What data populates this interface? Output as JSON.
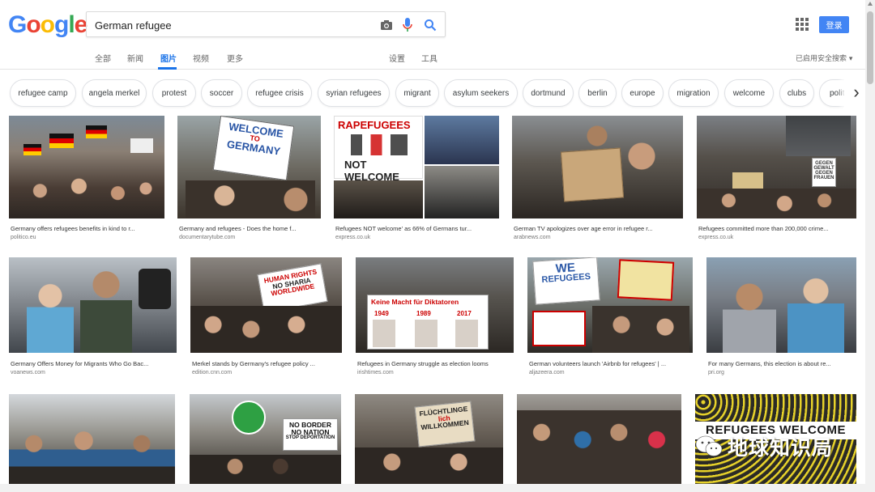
{
  "logo": {
    "letters": [
      "G",
      "o",
      "o",
      "g",
      "l",
      "e"
    ],
    "colors": [
      "#4285f4",
      "#ea4335",
      "#fbbc05",
      "#4285f4",
      "#34a853",
      "#ea4335"
    ]
  },
  "search": {
    "query": "German refugee"
  },
  "header": {
    "login_label": "登录"
  },
  "nav": {
    "tabs": [
      "全部",
      "新闻",
      "图片",
      "视频",
      "更多"
    ],
    "active_tab": "图片",
    "settings": "设置",
    "tools": "工具",
    "safe_search": "已启用安全搜索 ▾"
  },
  "chips": [
    "refugee camp",
    "angela merkel",
    "protest",
    "soccer",
    "refugee crisis",
    "syrian refugees",
    "migrant",
    "asylum seekers",
    "dortmund",
    "berlin",
    "europe",
    "migration",
    "welcome",
    "clubs",
    "politi"
  ],
  "results": [
    {
      "caption": "Germany offers refugees benefits in kind to r...",
      "source": "politico.eu"
    },
    {
      "caption": "Germany and refugees - Does the home f...",
      "source": "documentarytube.com"
    },
    {
      "caption": "Refugees NOT welcome' as 66% of Germans tur...",
      "source": "express.co.uk"
    },
    {
      "caption": "German TV apologizes over age error in refugee r...",
      "source": "arabnews.com"
    },
    {
      "caption": "Refugees committed more than 200,000 crime...",
      "source": "express.co.uk"
    },
    {
      "caption": "Germany Offers Money for Migrants Who Go Bac...",
      "source": "voanews.com"
    },
    {
      "caption": "Merkel stands by Germany's refugee policy ...",
      "source": "edition.cnn.com"
    },
    {
      "caption": "Refugees in Germany struggle as election looms",
      "source": "irishtimes.com"
    },
    {
      "caption": "German volunteers launch 'Airbnb for refugees' | ...",
      "source": "aljazeera.com"
    },
    {
      "caption": "For many Germans, this election is about re...",
      "source": "pri.org"
    },
    {
      "caption": "",
      "source": ""
    },
    {
      "caption": "",
      "source": ""
    },
    {
      "caption": "",
      "source": ""
    },
    {
      "caption": "",
      "source": ""
    },
    {
      "caption": "",
      "source": ""
    }
  ],
  "image_text": {
    "welcome_germany": [
      "WELCOME",
      "TO",
      "GERMANY"
    ],
    "rapefugees": [
      "RAPEFUGEES",
      "NOT WELCOME"
    ],
    "human_rights": [
      "HUMAN RIGHTS",
      "NO SHARIA",
      "WORLDWIDE"
    ],
    "keine_macht": [
      "Keine Macht für Diktatoren",
      "1949",
      "1989",
      "2017"
    ],
    "we_refugees": [
      "WE",
      "REFUGEES"
    ],
    "no_border": [
      "NO BORDER",
      "NO NATION",
      "STOP DEPORTATION"
    ],
    "fluchtlinge": [
      "FLÜCHTLINGE",
      "lich",
      "WILLKOMMEN"
    ],
    "refugees_welcome": "REFUGEES WELCOME",
    "gegen": [
      "GEGEN",
      "GEWALT",
      "GEGEN",
      "FRAUEN"
    ]
  },
  "watermark": "地球知识局"
}
